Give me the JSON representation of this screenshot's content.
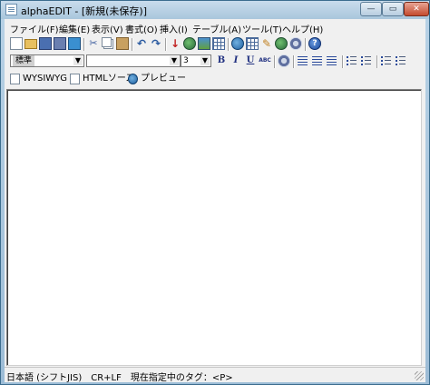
{
  "window": {
    "title": "alphaEDIT - [新規(未保存)]",
    "min_glyph": "—",
    "max_glyph": "▭",
    "close_glyph": "✕"
  },
  "menu": [
    "ファイル(F)",
    "編集(E)",
    "表示(V)",
    "書式(O)",
    "挿入(I)",
    "テーブル(A)",
    "ツール(T)",
    "ヘルプ(H)"
  ],
  "format_bar": {
    "style_value": "標準",
    "font_value": "",
    "size_value": "3",
    "bold": "B",
    "italic": "I",
    "underline": "U",
    "strike": "ABC"
  },
  "icons": {
    "undo": "↶",
    "redo": "↷",
    "cut": "✂",
    "help": "?",
    "pen": "✎",
    "dl": "↓"
  },
  "view_tabs": [
    "WYSIWYG",
    "HTMLソース",
    "プレビュー"
  ],
  "status": {
    "text": "日本語 (シフトJIS)　CR+LF　現在指定中のタグ：<P>"
  },
  "editor": {
    "content": ""
  }
}
